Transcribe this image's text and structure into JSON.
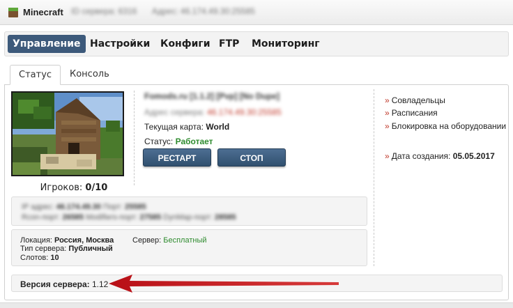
{
  "header": {
    "game": "Minecraft",
    "id_label": "ID сервера: 6316",
    "addr_label": "Адрес: 46.174.49.30:25585"
  },
  "nav": {
    "items": [
      "Управление",
      "Настройки",
      "Конфиги",
      "FTP",
      "Мониторинг"
    ],
    "active": "Управление"
  },
  "tabs": {
    "status": "Статус",
    "console": "Консоль"
  },
  "server": {
    "name": "Fomods.ru [1.1.2] [Pvp] [No Dupe]",
    "address_key": "Адрес сервера:",
    "address_value": "46.174.49.30:25585",
    "map_label": "Текущая карта:",
    "map_value": "World",
    "status_label": "Статус:",
    "status_value": "Работает",
    "players_label": "Игроков:",
    "players_value": "0/10"
  },
  "buttons": {
    "restart": "РЕСТАРТ",
    "stop": "СТОП"
  },
  "side": {
    "co_owners": "Совладельцы",
    "schedules": "Расписания",
    "hw_lock": "Блокировка на оборудовании",
    "created_label": "Дата создания:",
    "created_value": "05.05.2017"
  },
  "network": {
    "ip_key": "IP адрес:",
    "ip_value": "46.174.49.30",
    "port_key": "Порт:",
    "port_value": "25585",
    "rcon_key": "Rcon-порт:",
    "rcon_value": "26585",
    "mod_key": "Modifiers-порт:",
    "mod_value": "27585",
    "dyn_key": "DynMap-порт:",
    "dyn_value": "28585"
  },
  "details": {
    "location_label": "Локация:",
    "location_value": "Россия, Москва",
    "type_label": "Тип сервера:",
    "type_value": "Публичный",
    "slots_label": "Слотов:",
    "slots_value": "10",
    "plan_label": "Сервер:",
    "plan_value": "Бесплатный"
  },
  "version": {
    "label": "Версия сервера:",
    "value": "1.12"
  },
  "colors": {
    "nav_active": "#3d5a7b",
    "button": "#3d5a7b",
    "status_green": "#2e8b2e",
    "link_arrow": "#c0392b",
    "annotation_arrow": "#c0141c"
  }
}
